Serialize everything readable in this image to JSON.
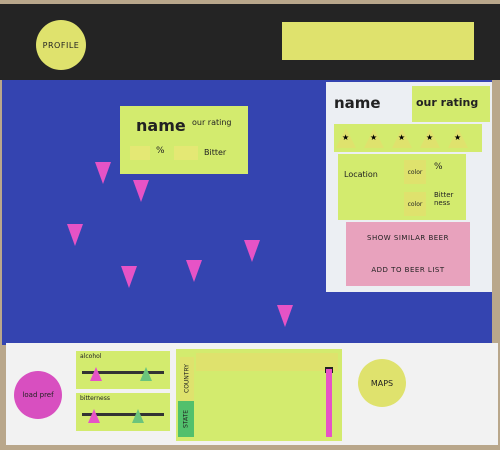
{
  "header": {
    "profile_label": "PROFILE"
  },
  "map_popup": {
    "name": "name",
    "rating_label": "our rating",
    "percent_label": "%",
    "bitter_label": "Bitter"
  },
  "detail_panel": {
    "name": "name",
    "rating_label": "our rating",
    "stars": [
      "★",
      "★",
      "★",
      "★",
      "★"
    ],
    "location_label": "Location",
    "color_label": "color",
    "percent_label": "%",
    "color_label_2": "color",
    "bitterness_label": "Bitter ness",
    "show_similar_label": "SHOW SIMILAR BEER",
    "add_to_list_label": "ADD TO BEER LIST"
  },
  "toolbar": {
    "load_pref_label": "load pref",
    "alcohol_label": "alcohol",
    "bitterness_label": "bitterness",
    "state_label": "STATE",
    "country_label": "COUNTRY",
    "maps_label": "MAPS"
  },
  "colors": {
    "map_blue": "#3444b0",
    "header_black": "#242424",
    "paper_green": "#d3eb6e",
    "paper_yellow": "#dfe26d",
    "pin_magenta": "#e653c6",
    "button_pink": "#e8a2bd"
  }
}
